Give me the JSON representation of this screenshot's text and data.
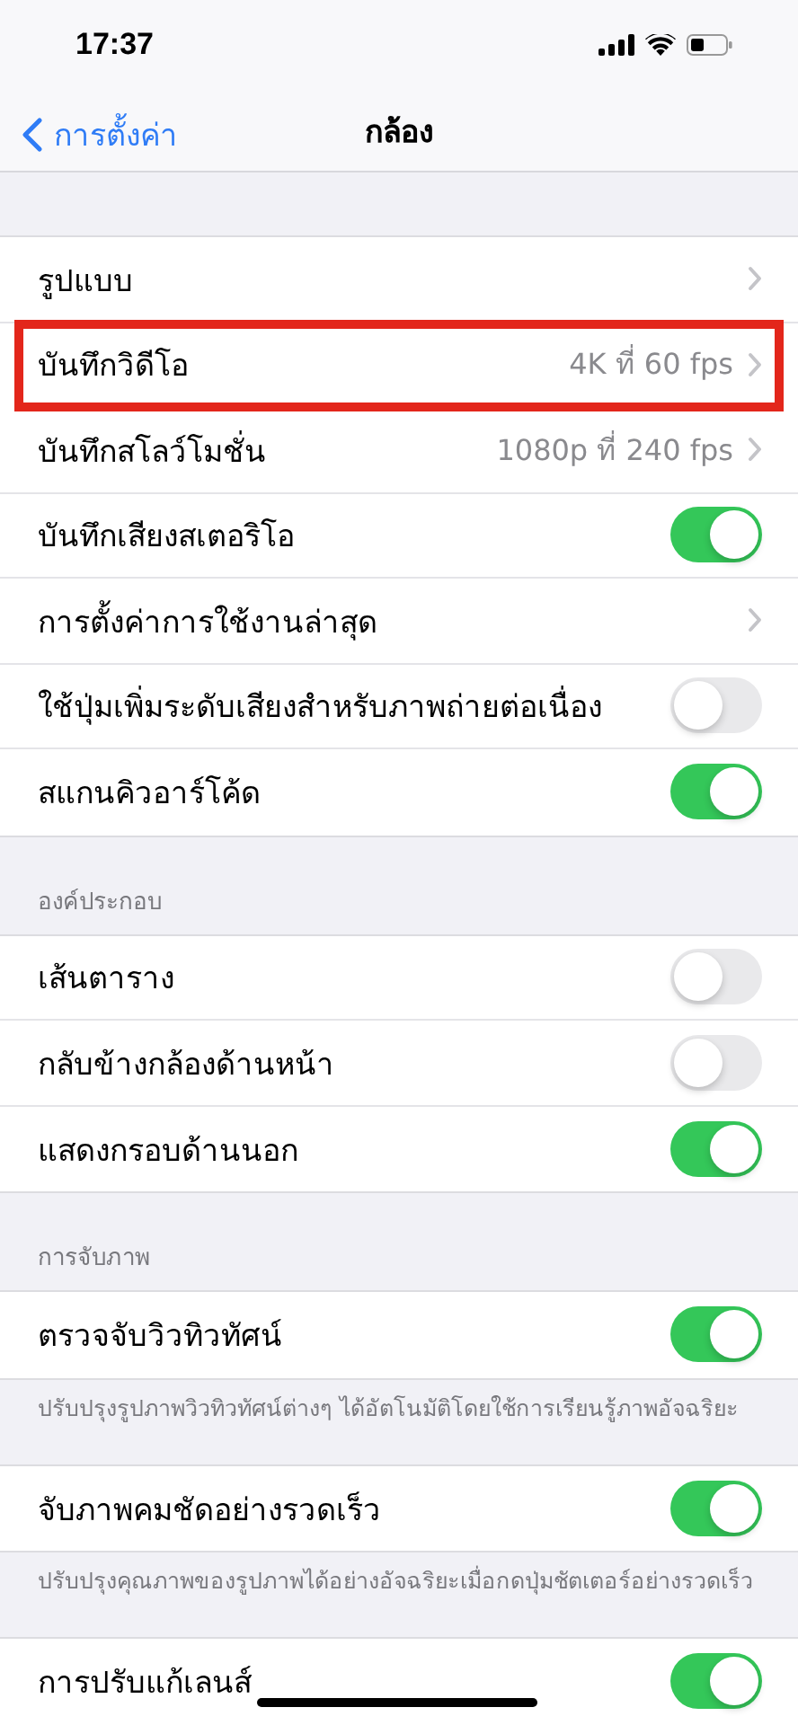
{
  "status_bar": {
    "time": "17:37"
  },
  "nav": {
    "back": "การตั้งค่า",
    "title": "กล้อง"
  },
  "sections": [
    {
      "rows": [
        {
          "kind": "link",
          "label": "รูปแบบ",
          "highlighted": false
        },
        {
          "kind": "link",
          "label": "บันทึกวิดีโอ",
          "value": "4K ที่ 60 fps",
          "highlighted": true
        },
        {
          "kind": "link",
          "label": "บันทึกสโลว์โมชั่น",
          "value": "1080p ที่ 240 fps",
          "highlighted": false
        },
        {
          "kind": "toggle",
          "label": "บันทึกเสียงสเตอริโอ",
          "on": true,
          "highlighted": false
        },
        {
          "kind": "link",
          "label": "การตั้งค่าการใช้งานล่าสุด",
          "highlighted": false
        },
        {
          "kind": "toggle",
          "label": "ใช้ปุ่มเพิ่มระดับเสียงสำหรับภาพถ่ายต่อเนื่อง",
          "on": false,
          "highlighted": false
        },
        {
          "kind": "toggle",
          "label": "สแกนคิวอาร์โค้ด",
          "on": true,
          "highlighted": false
        }
      ]
    },
    {
      "header": "องค์ประกอบ",
      "rows": [
        {
          "kind": "toggle",
          "label": "เส้นตาราง",
          "on": false,
          "highlighted": false
        },
        {
          "kind": "toggle",
          "label": "กลับข้างกล้องด้านหน้า",
          "on": false,
          "highlighted": false
        },
        {
          "kind": "toggle",
          "label": "แสดงกรอบด้านนอก",
          "on": true,
          "highlighted": false
        }
      ]
    },
    {
      "header": "การจับภาพ",
      "rows": [
        {
          "kind": "toggle",
          "label": "ตรวจจับวิวทิวทัศน์",
          "on": true,
          "highlighted": false
        }
      ],
      "footer": "ปรับปรุงรูปภาพวิวทิวทัศน์ต่างๆ ได้อัตโนมัติโดยใช้การเรียนรู้ภาพอัจฉริยะ"
    },
    {
      "rows": [
        {
          "kind": "toggle",
          "label": "จับภาพคมชัดอย่างรวดเร็ว",
          "on": true,
          "highlighted": false
        }
      ],
      "footer": "ปรับปรุงคุณภาพของรูปภาพได้อย่างอัจฉริยะเมื่อกดปุ่มชัตเตอร์อย่างรวดเร็ว"
    },
    {
      "rows": [
        {
          "kind": "toggle",
          "label": "การปรับแก้เลนส์",
          "on": true,
          "highlighted": false
        }
      ]
    }
  ]
}
